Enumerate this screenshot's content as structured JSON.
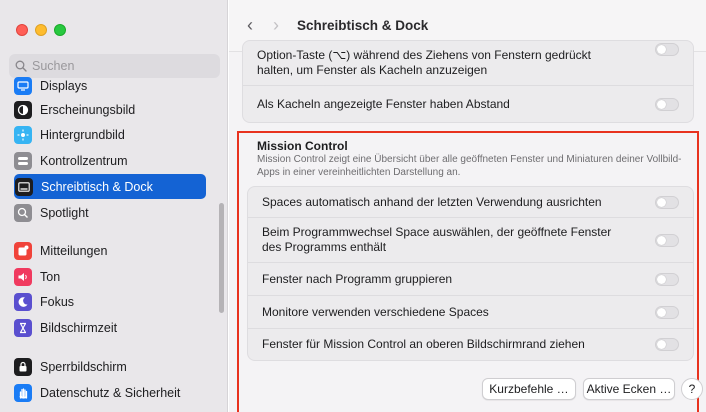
{
  "window": {
    "title": "Schreibtisch & Dock"
  },
  "search": {
    "placeholder": "Suchen",
    "value": ""
  },
  "sidebar": {
    "items": [
      {
        "label": "Displays",
        "icon": "display-icon",
        "color": "#1a7cf5"
      },
      {
        "label": "Erscheinungsbild",
        "icon": "appearance-icon",
        "color": "#1d1d1f"
      },
      {
        "label": "Hintergrundbild",
        "icon": "wallpaper-icon",
        "color": "#36b4f3"
      },
      {
        "label": "Kontrollzentrum",
        "icon": "control-center-icon",
        "color": "#8e8d92"
      },
      {
        "label": "Schreibtisch & Dock",
        "icon": "dock-icon",
        "color": "#1d1d1f",
        "active": true
      },
      {
        "label": "Spotlight",
        "icon": "spotlight-icon",
        "color": "#8e8d92"
      },
      {
        "label": "Mitteilungen",
        "icon": "notifications-icon",
        "color": "#f0433a"
      },
      {
        "label": "Ton",
        "icon": "sound-icon",
        "color": "#f03a5f"
      },
      {
        "label": "Fokus",
        "icon": "focus-icon",
        "color": "#5a4fcf"
      },
      {
        "label": "Bildschirmzeit",
        "icon": "screen-time-icon",
        "color": "#5a4fcf"
      },
      {
        "label": "Sperrbildschirm",
        "icon": "lock-screen-icon",
        "color": "#1d1d1f"
      },
      {
        "label": "Datenschutz & Sicherheit",
        "icon": "privacy-hand-icon",
        "color": "#1a7cf5"
      }
    ]
  },
  "windows_group": {
    "rows": [
      {
        "label": "Option-Taste (⌥) während des Ziehens von Fenstern gedrückt halten, um Fenster als Kacheln anzuzeigen",
        "on": false
      },
      {
        "label": "Als Kacheln angezeigte Fenster haben Abstand",
        "on": false
      }
    ]
  },
  "mission_control": {
    "title": "Mission Control",
    "description": "Mission Control zeigt eine Übersicht über alle geöffneten Fenster und Miniaturen deiner Vollbild-Apps in einer vereinheitlichten Darstellung an.",
    "highlight_color": "#e8321e",
    "rows": [
      {
        "label": "Spaces automatisch anhand der letzten Verwendung ausrichten",
        "on": false
      },
      {
        "label": "Beim Programmwechsel Space auswählen, der geöffnete Fenster des Programms enthält",
        "on": false
      },
      {
        "label": "Fenster nach Programm gruppieren",
        "on": false
      },
      {
        "label": "Monitore verwenden verschiedene Spaces",
        "on": false
      },
      {
        "label": "Fenster für Mission Control an oberen Bildschirmrand ziehen",
        "on": false
      }
    ]
  },
  "footer": {
    "shortcuts_label": "Kurzbefehle …",
    "hot_corners_label": "Aktive Ecken …",
    "help_label": "?"
  },
  "accent_color": "#1463d4"
}
